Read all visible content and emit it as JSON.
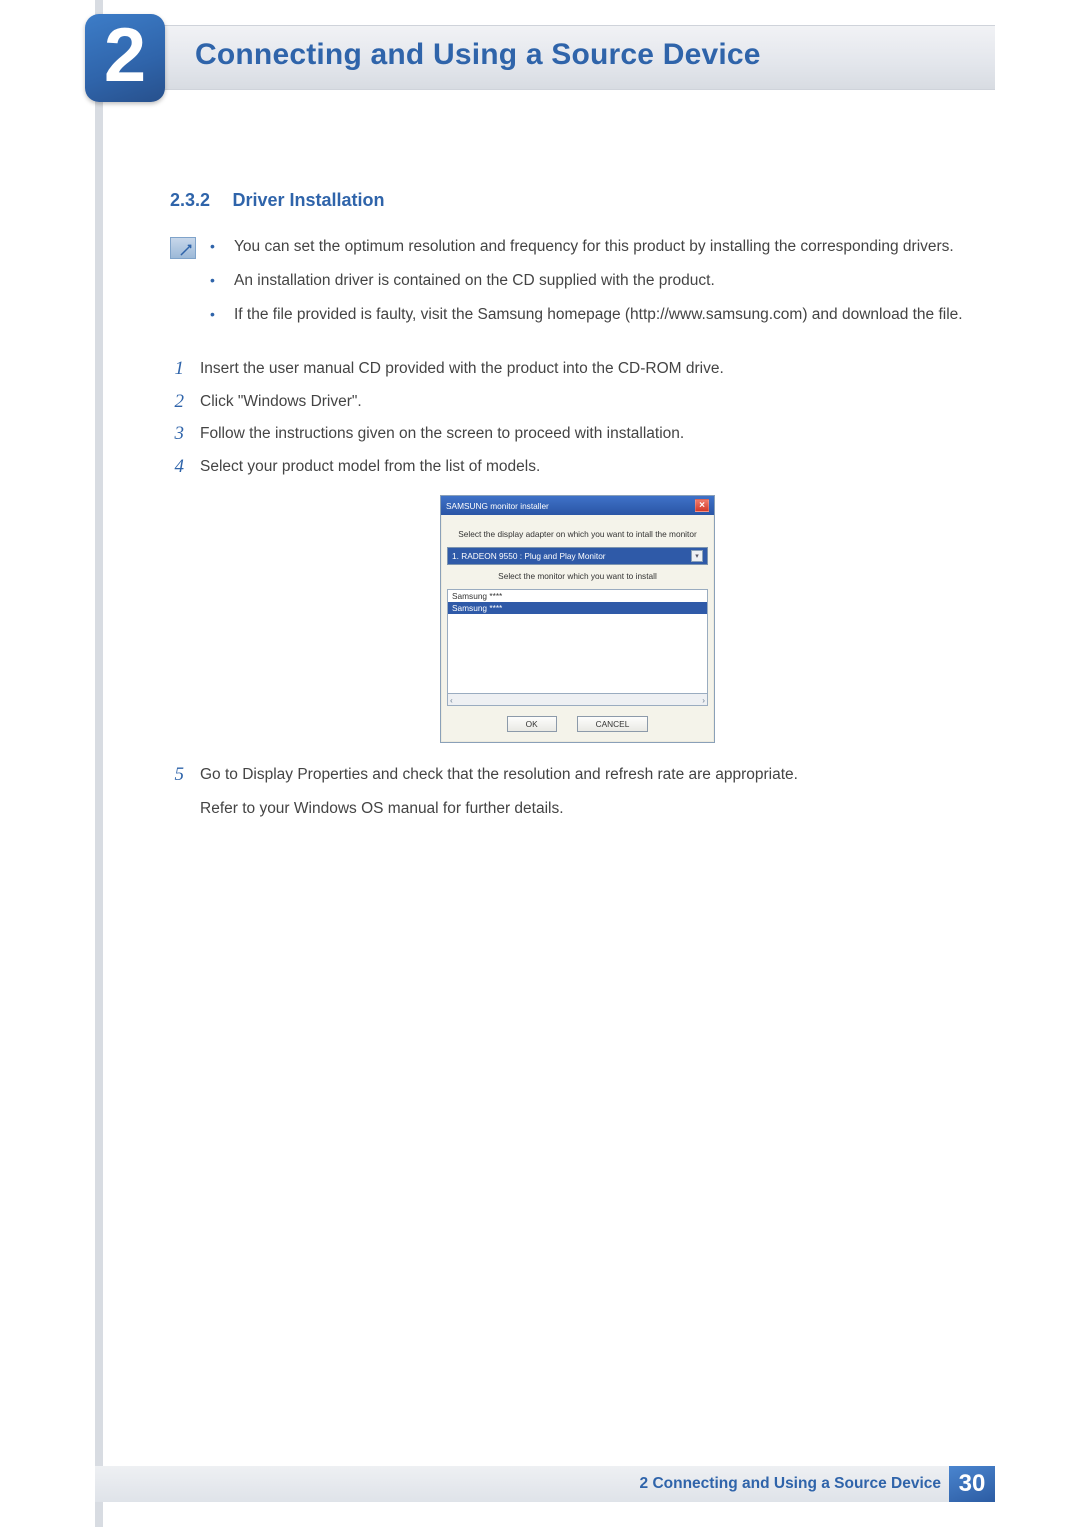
{
  "chapter": {
    "number": "2",
    "title": "Connecting and Using a Source Device"
  },
  "section": {
    "number": "2.3.2",
    "title": "Driver Installation"
  },
  "notes": [
    "You can set the optimum resolution and frequency for this product by installing the corresponding drivers.",
    "An installation driver is contained on the CD supplied with the product.",
    "If the file provided is faulty, visit the Samsung homepage (http://www.samsung.com) and download the file."
  ],
  "steps": {
    "s1": {
      "n": "1",
      "text": "Insert the user manual CD provided with the product into the CD-ROM drive."
    },
    "s2": {
      "n": "2",
      "text": "Click \"Windows Driver\"."
    },
    "s3": {
      "n": "3",
      "text": "Follow the instructions given on the screen to proceed with installation."
    },
    "s4": {
      "n": "4",
      "text": "Select your product model from the list of models."
    },
    "s5": {
      "n": "5",
      "text": "Go to Display Properties and check that the resolution and refresh rate are appropriate.",
      "sub": "Refer to your Windows OS manual for further details."
    }
  },
  "installer": {
    "title": "SAMSUNG monitor installer",
    "close": "×",
    "adapter_label": "Select the display adapter on which you want to intall the monitor",
    "adapter_value": "1. RADEON 9550 : Plug and Play Monitor",
    "monitor_label": "Select the monitor which you want to install",
    "list_item1": "Samsung ****",
    "list_item2": "Samsung ****",
    "ok": "OK",
    "cancel": "CANCEL",
    "left_arrow": "‹",
    "right_arrow": "›",
    "dd_glyph": "▾"
  },
  "footer": {
    "label": "2 Connecting and Using a Source Device",
    "page": "30"
  }
}
